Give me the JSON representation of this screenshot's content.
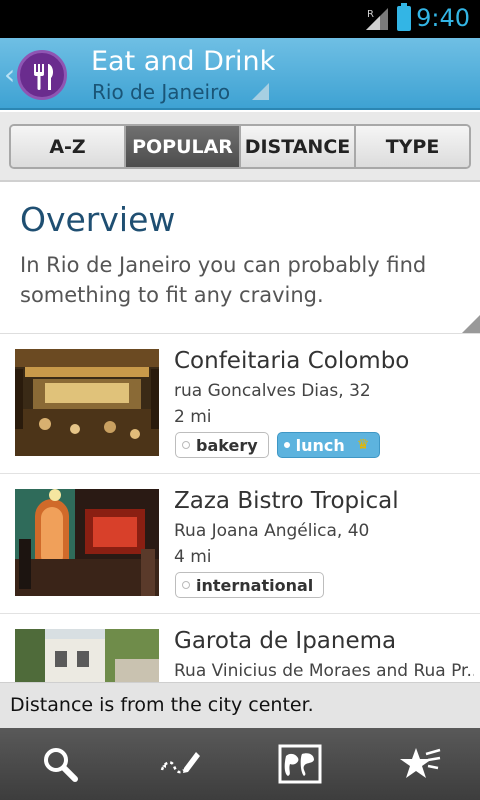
{
  "status_bar": {
    "time": "9:40",
    "signal_label": "R",
    "icons": [
      "signal-icon",
      "battery-icon"
    ]
  },
  "action_bar": {
    "title": "Eat and Drink",
    "subtitle": "Rio de Janeiro",
    "icon": "fork-knife-icon",
    "accent_color": "#6a2c8e"
  },
  "tabs": [
    {
      "label": "A-Z",
      "active": false
    },
    {
      "label": "POPULAR",
      "active": true
    },
    {
      "label": "DISTANCE",
      "active": false
    },
    {
      "label": "TYPE",
      "active": false
    }
  ],
  "overview": {
    "title": "Overview",
    "text": "In Rio de Janeiro you can probably find something to fit any craving."
  },
  "items": [
    {
      "name": "Confeitaria Colombo",
      "address": "rua Goncalves Dias, 32",
      "distance": "2 mi",
      "tags": [
        {
          "label": "bakery",
          "highlight": false
        },
        {
          "label": "lunch",
          "highlight": true,
          "icon": "crown-icon"
        }
      ]
    },
    {
      "name": "Zaza Bistro Tropical",
      "address": "Rua Joana Angélica, 40",
      "distance": "4 mi",
      "tags": [
        {
          "label": "international",
          "highlight": false
        }
      ]
    },
    {
      "name": "Garota de Ipanema",
      "address": "Rua Vinicius de Moraes and Rua Pr...",
      "distance": "",
      "tags": []
    }
  ],
  "toast": {
    "text": "Distance is from the city center."
  },
  "bottom_nav": [
    "search-icon",
    "edit-route-icon",
    "map-icon",
    "favorites-star-icon"
  ]
}
